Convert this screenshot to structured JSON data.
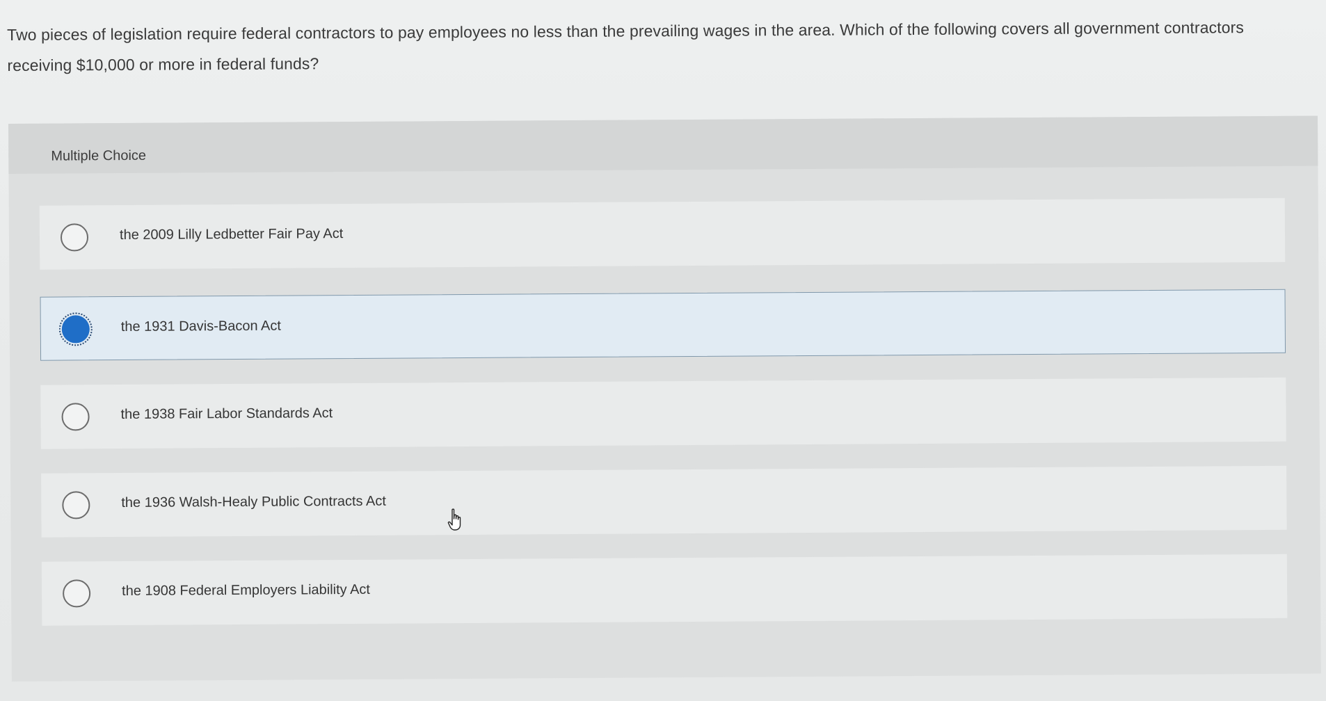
{
  "question": {
    "text": "Two pieces of legislation require federal contractors to pay employees no less than the prevailing wages in the area. Which of the following covers all government contractors receiving $10,000 or more in federal funds?"
  },
  "multiple_choice": {
    "header": "Multiple Choice",
    "selected_index": 1,
    "options": [
      {
        "label": "the 2009 Lilly Ledbetter Fair Pay Act",
        "selected": false
      },
      {
        "label": "the 1931 Davis-Bacon Act",
        "selected": true
      },
      {
        "label": "the 1938 Fair Labor Standards Act",
        "selected": false
      },
      {
        "label": "the 1936 Walsh-Healy Public Contracts Act",
        "selected": false
      },
      {
        "label": "the 1908 Federal Employers Liability Act",
        "selected": false
      }
    ]
  },
  "colors": {
    "selected_radio": "#1f6ec7",
    "selected_background": "#e1ebf3",
    "selected_border": "#7f97aa"
  },
  "icons": {
    "cursor": "hand-pointer-icon"
  }
}
